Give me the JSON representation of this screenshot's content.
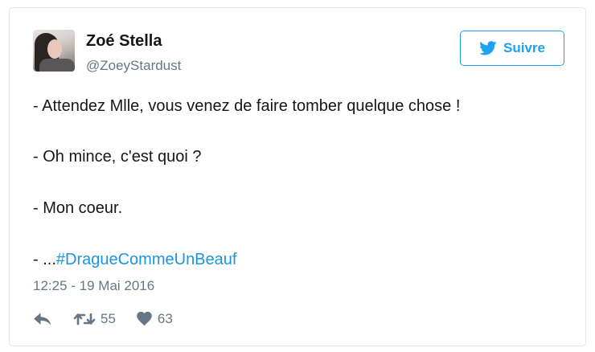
{
  "tweet": {
    "author": {
      "name": "Zoé Stella",
      "handle": "@ZoeyStardust"
    },
    "follow_button": {
      "label": "Suivre",
      "icon": "twitter-bird-icon"
    },
    "lines": {
      "line1": "- Attendez Mlle, vous venez de faire tomber quelque chose !",
      "line2": "- Oh mince, c'est quoi ?",
      "line3": "- Mon coeur.",
      "line4_prefix": "- ...",
      "hashtag": "#DragueCommeUnBeauf"
    },
    "timestamp": "12:25 - 19 Mai 2016",
    "actions": {
      "reply": {
        "icon": "reply-icon"
      },
      "retweet": {
        "icon": "retweet-icon",
        "count": "55"
      },
      "like": {
        "icon": "heart-icon",
        "count": "63"
      }
    }
  },
  "colors": {
    "accent": "#1da1f2",
    "hashtag": "#1b95e0",
    "muted": "#657786",
    "text": "#14171a",
    "border": "#e1e8ed"
  }
}
